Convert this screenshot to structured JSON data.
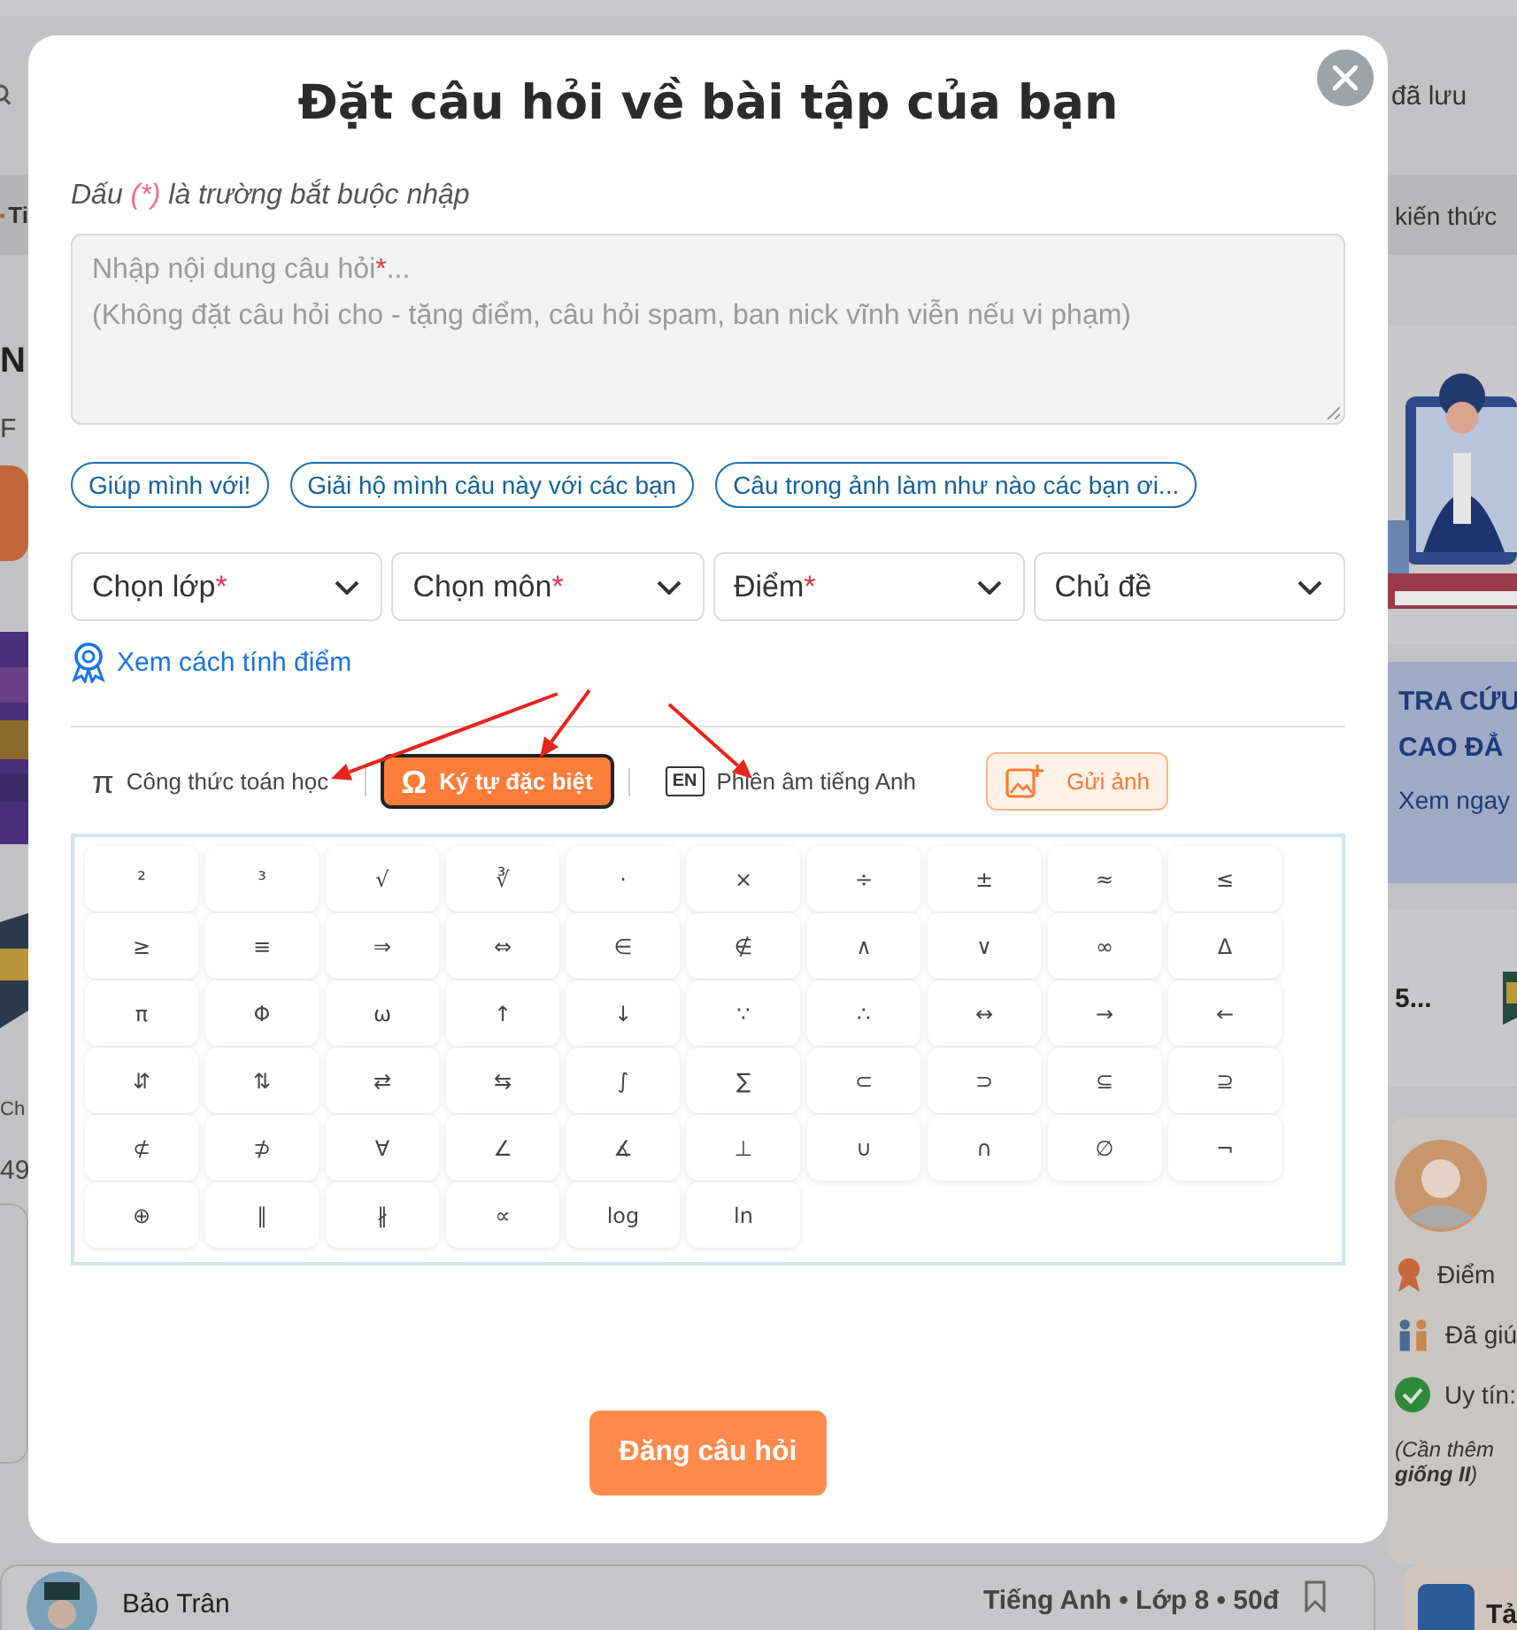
{
  "header": {
    "saved_label": "đã lưu"
  },
  "left_panel": {
    "tag": "Ti",
    "heading": "N",
    "subheading": "F",
    "section_label": "Ch",
    "count": "49"
  },
  "right_panel": {
    "band_text": "kiến thức",
    "banner": {
      "title_lines": [
        "TRA CỨU",
        "CAO ĐẲ"
      ],
      "link": "Xem ngay"
    },
    "stat": "5...",
    "profile": {
      "rows": [
        {
          "kind": "points",
          "label": "Điểm"
        },
        {
          "kind": "helped",
          "label": "Đã giú"
        },
        {
          "kind": "trust",
          "label": "Uy tín:"
        }
      ],
      "note_lines": [
        "(Cần thêm",
        "**giống II**)"
      ]
    }
  },
  "bottom_card": {
    "author": "Bảo Trân",
    "meta": "Tiếng Anh • Lớp 8 • 50đ"
  },
  "side_card": {
    "title": "Tả"
  },
  "modal": {
    "title": "Đặt câu hỏi về bài tập của bạn",
    "note": {
      "before": "Dấu",
      "mark": "(*)",
      "after": "là trường bắt buộc nhập"
    },
    "question": {
      "placeholder": {
        "text": "Nhập nội dung câu hỏi",
        "mark": "*",
        "tail": "...",
        "hint": "(Không đặt câu hỏi cho - tặng điểm, câu hỏi spam, ban nick vĩnh viễn nếu vi phạm)"
      }
    },
    "suggestions": [
      "Giúp mình với!",
      "Giải hộ mình câu này với các bạn",
      "Câu trong ảnh làm như nào các bạn ơi..."
    ],
    "selects": [
      {
        "label": "Chọn lớp",
        "mark": "*"
      },
      {
        "label": "Chọn môn",
        "mark": "*"
      },
      {
        "label": "Điểm",
        "mark": "*"
      },
      {
        "label": "Chủ đề"
      }
    ],
    "score_link": "Xem cách tính điểm",
    "tools": [
      {
        "kind": "math",
        "icon": "π",
        "label": "Công thức toán học",
        "selected": false
      },
      {
        "kind": "special",
        "icon": "Ω",
        "label": "Ký tự đặc biệt",
        "selected": true
      },
      {
        "kind": "phonetic",
        "icon": "EN",
        "label": "Phiên âm tiếng Anh",
        "selected": false
      }
    ],
    "upload_button": "Gửi ảnh",
    "symbols": [
      "²",
      "³",
      "√",
      "∛",
      "·",
      "×",
      "÷",
      "±",
      "≈",
      "≤",
      "≥",
      "≡",
      "⇒",
      "⇔",
      "∈",
      "∉",
      "∧",
      "∨",
      "∞",
      "Δ",
      "π",
      "Φ",
      "ω",
      "↑",
      "↓",
      "∵",
      "∴",
      "↔",
      "→",
      "←",
      "⇵",
      "⇅",
      "⇄",
      "⇆",
      "∫",
      "∑",
      "⊂",
      "⊃",
      "⊆",
      "⊇",
      "⊄",
      "⊅",
      "∀",
      "∠",
      "∡",
      "⊥",
      "∪",
      "∩",
      "∅",
      "¬",
      "⊕",
      "∥",
      "∦",
      "∝",
      "log",
      "ln"
    ],
    "submit": "Đăng câu hỏi"
  }
}
